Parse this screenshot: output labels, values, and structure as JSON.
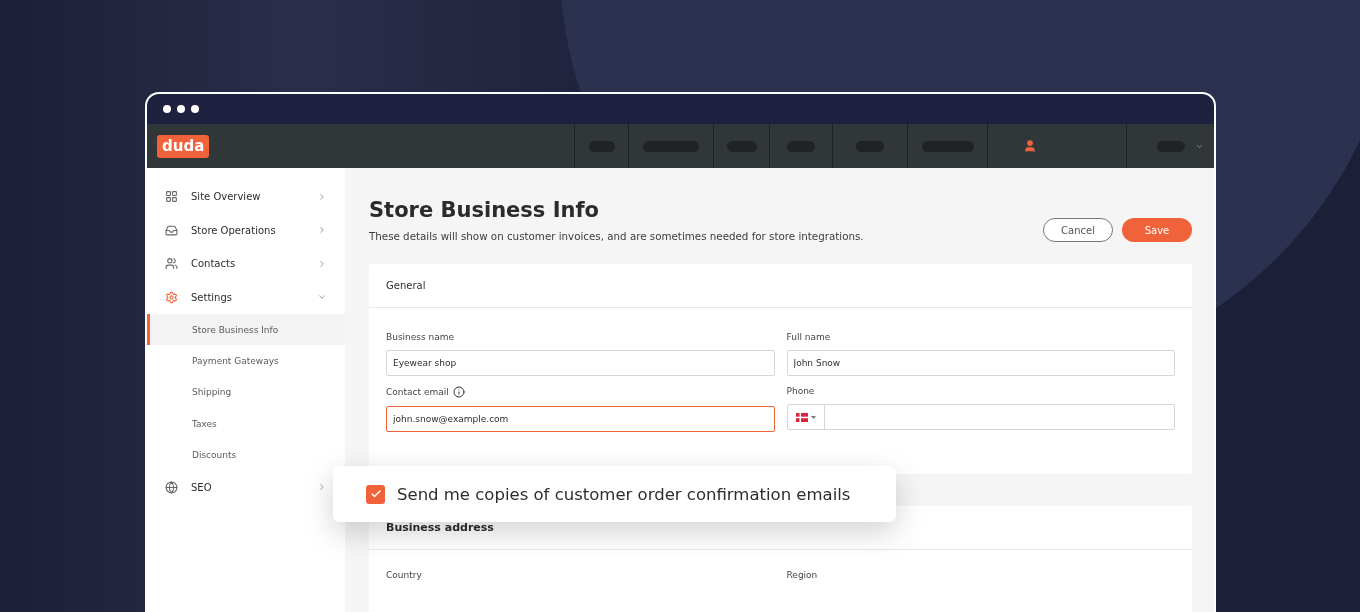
{
  "logo": "duda",
  "top_nav": {
    "segments": [
      {
        "kind": "pill"
      },
      {
        "kind": "pill"
      },
      {
        "kind": "pill"
      },
      {
        "kind": "pill"
      },
      {
        "kind": "pill"
      },
      {
        "kind": "pill"
      },
      {
        "kind": "user"
      },
      {
        "kind": "menu"
      }
    ]
  },
  "sidebar": {
    "items": [
      {
        "label": "Site Overview",
        "expanded": false
      },
      {
        "label": "Store Operations",
        "expanded": false
      },
      {
        "label": "Contacts",
        "expanded": false
      },
      {
        "label": "Settings",
        "expanded": true,
        "children": [
          {
            "label": "Store Business Info",
            "selected": true
          },
          {
            "label": "Payment Gateways",
            "selected": false
          },
          {
            "label": "Shipping",
            "selected": false
          },
          {
            "label": "Taxes",
            "selected": false
          },
          {
            "label": "Discounts",
            "selected": false
          }
        ]
      },
      {
        "label": "SEO",
        "expanded": false
      }
    ]
  },
  "page": {
    "title": "Store Business Info",
    "subtitle": "These details will show on customer invoices, and are sometimes needed for store integrations.",
    "buttons": [
      {
        "label": "Cancel",
        "kind": "secondary"
      },
      {
        "label": "Save",
        "kind": "primary"
      }
    ]
  },
  "general_card": {
    "title": "General",
    "fields": [
      {
        "label": "Business name",
        "value": "Eyewear shop",
        "kind": "text",
        "focused": false,
        "info": false
      },
      {
        "label": "Full name",
        "value": "John Snow",
        "kind": "text",
        "focused": false,
        "info": false
      },
      {
        "label": "Contact email",
        "value": "john.snow@example.com",
        "kind": "text",
        "focused": true,
        "info": true
      },
      {
        "label": "Phone",
        "kind": "phone",
        "focused": false,
        "info": false
      }
    ]
  },
  "popup_checkbox": {
    "label": "Send me copies of customer order confirmation emails",
    "checked": true
  },
  "address_card": {
    "title": "Business address",
    "fields": [
      {
        "label": "Country"
      },
      {
        "label": "Region"
      }
    ]
  }
}
